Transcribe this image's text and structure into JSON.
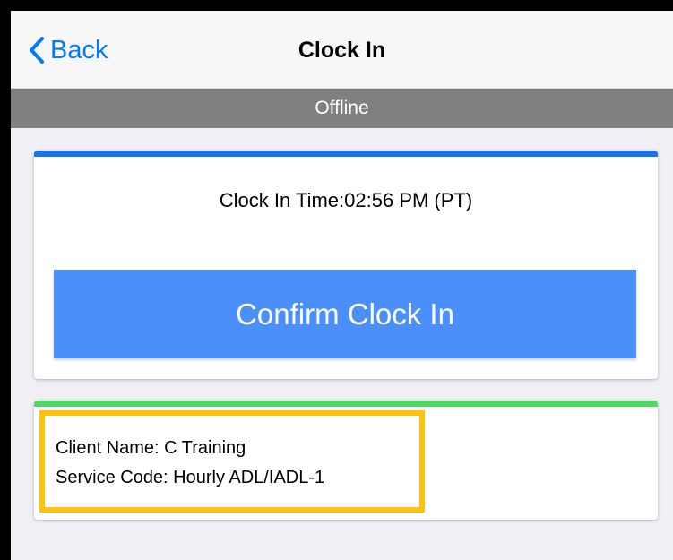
{
  "navbar": {
    "back_label": "Back",
    "title": "Clock In"
  },
  "status": {
    "label": "Offline"
  },
  "clock_card": {
    "time_text": "Clock In Time:02:56 PM (PT)",
    "confirm_label": "Confirm Clock In"
  },
  "client_card": {
    "client_name": "Client Name: C Training",
    "service_code": "Service Code: Hourly ADL/IADL-1"
  },
  "colors": {
    "accent_blue": "#007aff",
    "button_blue": "#4b8ffb",
    "clock_card_bar": "#1a73e8",
    "client_card_bar": "#4cd964",
    "offline_bar": "#808080",
    "highlight": "#ffc20e"
  },
  "icons": {
    "back": "chevron-left-icon"
  }
}
